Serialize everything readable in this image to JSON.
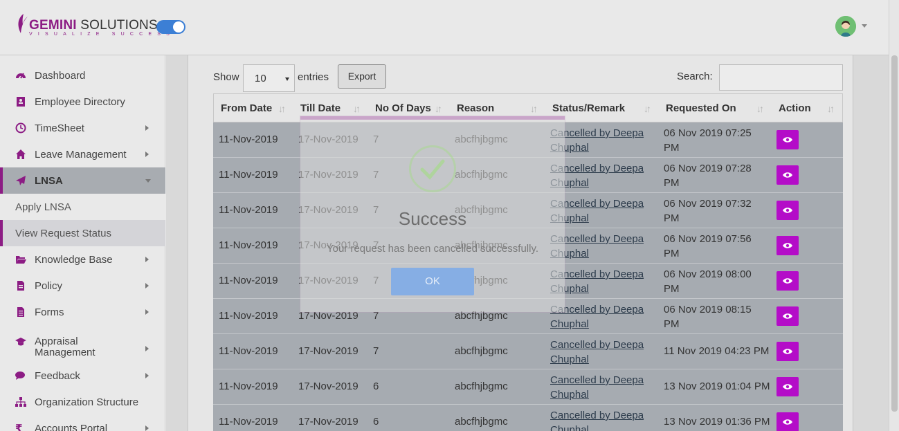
{
  "brand": {
    "name_bold": "GEMINI",
    "name_rest": " SOLUTIONS",
    "tagline": "VISUALIZE SUCCESS",
    "accent": "#8c1c84"
  },
  "sidebar": {
    "items": [
      {
        "label": "Dashboard",
        "icon": "dashboard-icon"
      },
      {
        "label": "Employee Directory",
        "icon": "address-book-icon"
      },
      {
        "label": "TimeSheet",
        "icon": "clock-icon"
      },
      {
        "label": "Leave Management",
        "icon": "home-icon"
      },
      {
        "label": "LNSA",
        "icon": "paper-plane-icon"
      },
      {
        "label": "Knowledge Base",
        "icon": "folder-open-icon"
      },
      {
        "label": "Policy",
        "icon": "file-icon"
      },
      {
        "label": "Forms",
        "icon": "file-text-icon"
      },
      {
        "label": "Appraisal Management",
        "icon": "graduation-cap-icon"
      },
      {
        "label": "Feedback",
        "icon": "comments-icon"
      },
      {
        "label": "Organization Structure",
        "icon": "sitemap-icon"
      },
      {
        "label": "Accounts Portal",
        "icon": "rupee-icon"
      }
    ],
    "lnsa_sub": [
      "Apply LNSA",
      "View Request Status"
    ]
  },
  "controls": {
    "show_label": "Show",
    "entries_value": "10",
    "entries_label": "entries",
    "export_label": "Export",
    "search_label": "Search:",
    "search_value": ""
  },
  "table": {
    "headers": [
      "From Date",
      "Till Date",
      "No Of Days",
      "Reason",
      "Status/Remark",
      "Requested On",
      "Action"
    ],
    "rows": [
      {
        "from": "11-Nov-2019",
        "till": "17-Nov-2019",
        "days": "7",
        "reason": "abcfhjbgmc",
        "status1": "Cancelled by Deepa",
        "status2": "Chuphal",
        "req1": "06 Nov 2019 07:25",
        "req2": "PM"
      },
      {
        "from": "11-Nov-2019",
        "till": "17-Nov-2019",
        "days": "7",
        "reason": "abcfhjbgmc",
        "status1": "Cancelled by Deepa",
        "status2": "Chuphal",
        "req1": "06 Nov 2019 07:28",
        "req2": "PM"
      },
      {
        "from": "11-Nov-2019",
        "till": "17-Nov-2019",
        "days": "7",
        "reason": "abcfhjbgmc",
        "status1": "Cancelled by Deepa",
        "status2": "Chuphal",
        "req1": "06 Nov 2019 07:32",
        "req2": "PM"
      },
      {
        "from": "11-Nov-2019",
        "till": "17-Nov-2019",
        "days": "7",
        "reason": "abcfhjbgmc",
        "status1": "Cancelled by Deepa",
        "status2": "Chuphal",
        "req1": "06 Nov 2019 07:56",
        "req2": "PM"
      },
      {
        "from": "11-Nov-2019",
        "till": "17-Nov-2019",
        "days": "7",
        "reason": "abcfhjbgmc",
        "status1": "Cancelled by Deepa",
        "status2": "Chuphal",
        "req1": "06 Nov 2019 08:00",
        "req2": "PM"
      },
      {
        "from": "11-Nov-2019",
        "till": "17-Nov-2019",
        "days": "7",
        "reason": "abcfhjbgmc",
        "status1": "Cancelled by Deepa",
        "status2": "Chuphal",
        "req1": "06 Nov 2019 08:15",
        "req2": "PM"
      },
      {
        "from": "11-Nov-2019",
        "till": "17-Nov-2019",
        "days": "7",
        "reason": "abcfhjbgmc",
        "status1": "Cancelled by Deepa",
        "status2": "Chuphal",
        "req1": "11 Nov 2019 04:23 PM",
        "req2": ""
      },
      {
        "from": "11-Nov-2019",
        "till": "17-Nov-2019",
        "days": "6",
        "reason": "abcfhjbgmc",
        "status1": "Cancelled by Deepa",
        "status2": "Chuphal",
        "req1": "13 Nov 2019 01:04 PM",
        "req2": ""
      },
      {
        "from": "11-Nov-2019",
        "till": "17-Nov-2019",
        "days": "6",
        "reason": "abcfhjbgmc",
        "status1": "Cancelled by Deepa",
        "status2": "Chuphal",
        "req1": "13 Nov 2019 01:36 PM",
        "req2": ""
      }
    ]
  },
  "modal": {
    "title": "Success",
    "message": "Your request has been cancelled successfully.",
    "ok_label": "OK"
  }
}
